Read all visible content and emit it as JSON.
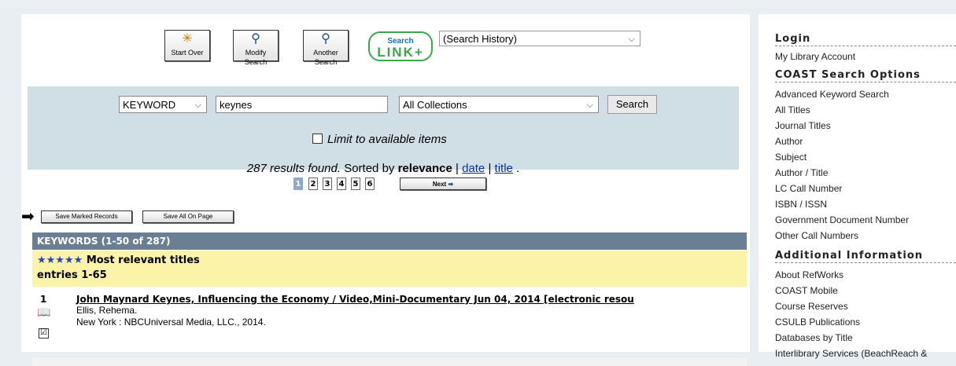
{
  "toolbar": {
    "start_over": "Start Over",
    "modify_search": "Modify Search",
    "another_search": "Another Search",
    "searchlink_top": "Search",
    "searchlink_bottom": "LINK+",
    "history_value": "(Search History)"
  },
  "search": {
    "field_value": "KEYWORD",
    "query_value": "keynes",
    "collection_value": "All Collections",
    "button_label": "Search",
    "limit_label": "Limit to available items"
  },
  "results_summary": {
    "found_text": "287 results found.",
    "sorted_text": "Sorted by",
    "sort_current": "relevance",
    "sort_date": "date",
    "sort_title": "title",
    "separator": "|",
    "period": "."
  },
  "pager": {
    "pages": [
      "1",
      "2",
      "3",
      "4",
      "5",
      "6"
    ],
    "current": "1",
    "next_label": "Next"
  },
  "actions": {
    "save_marked": "Save Marked Records",
    "save_all": "Save All On Page"
  },
  "keywords_bar": "KEYWORDS (1-50 of 287)",
  "relevance": {
    "stars": "★★★★★",
    "heading": "Most relevant titles",
    "entries": "entries 1-65"
  },
  "records": [
    {
      "num": "1",
      "title": "John Maynard Keynes, Influencing the Economy / Video,Mini-Documentary Jun 04, 2014 [electronic resou",
      "author": "Ellis, Rehema.",
      "publisher": "New York : NBCUniversal Media, LLC., 2014.",
      "checked": "☑"
    }
  ],
  "sidebar": {
    "login_heading": "Login",
    "login_items": [
      "My Library Account"
    ],
    "coast_heading": "COAST Search Options",
    "coast_items": [
      "Advanced Keyword Search",
      "All Titles",
      "Journal Titles",
      "Author",
      "Subject",
      "Author / Title",
      "LC Call Number",
      "ISBN / ISSN",
      "Government Document Number",
      "Other Call Numbers"
    ],
    "additional_heading": "Additional Information",
    "additional_items": [
      "About RefWorks",
      "COAST Mobile",
      "Course Reserves",
      "CSULB Publications",
      "Databases by Title",
      "Interlibrary Services (BeachReach &"
    ]
  }
}
